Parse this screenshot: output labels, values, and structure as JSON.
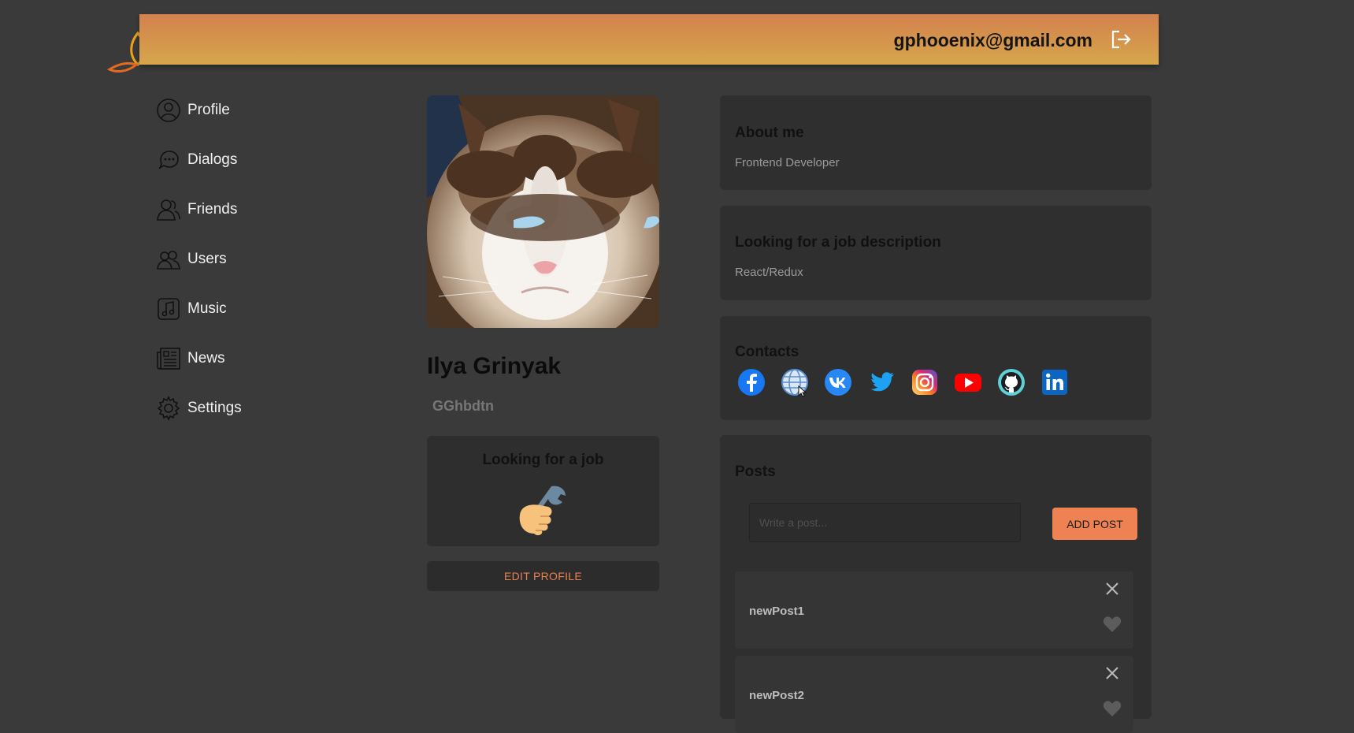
{
  "header": {
    "email": "gphooenix@gmail.com",
    "gradient_start": "#d3814d",
    "gradient_end": "#d6a64c"
  },
  "nav": {
    "items": [
      {
        "label": "Profile",
        "icon": "user-icon"
      },
      {
        "label": "Dialogs",
        "icon": "chat-bubble-icon"
      },
      {
        "label": "Friends",
        "icon": "friends-icon"
      },
      {
        "label": "Users",
        "icon": "users-icon"
      },
      {
        "label": "Music",
        "icon": "music-note-icon"
      },
      {
        "label": "News",
        "icon": "newspaper-icon"
      },
      {
        "label": "Settings",
        "icon": "gear-icon"
      }
    ]
  },
  "profile": {
    "name": "Ilya Grinyak",
    "status": "GGhbdtn",
    "job_card_title": "Looking for a job",
    "job_icon": "handshake-wrench-icon",
    "edit_button": "EDIT PROFILE"
  },
  "about": {
    "title": "About me",
    "text": "Frontend Developer"
  },
  "job_description": {
    "title": "Looking for a job description",
    "text": "React/Redux"
  },
  "contacts": {
    "title": "Contacts",
    "icons": [
      "facebook-icon",
      "website-icon",
      "vk-icon",
      "twitter-icon",
      "instagram-icon",
      "youtube-icon",
      "github-icon",
      "linkedin-icon"
    ]
  },
  "posts": {
    "title": "Posts",
    "input_placeholder": "Write a post...",
    "add_button": "ADD POST",
    "items": [
      {
        "text": "newPost1"
      },
      {
        "text": "newPost2"
      }
    ]
  },
  "colors": {
    "background": "#3a3a3a",
    "card": "#2f2f2f",
    "accent": "#ee8252"
  }
}
